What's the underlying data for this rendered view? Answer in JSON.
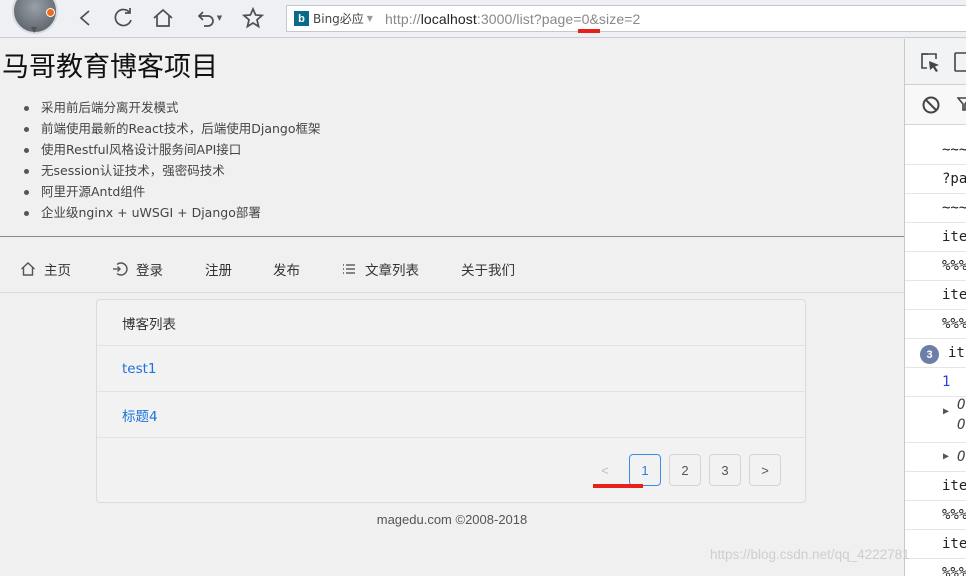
{
  "browser": {
    "search_engine": "Bing必应",
    "url_prefix": "http://",
    "url_host": "localhost",
    "url_rest": ":3000/list?page=0&size=2",
    "accent_mark_color": "#e8201a"
  },
  "site": {
    "title": "马哥教育博客项目",
    "features": [
      "采用前后端分离开发模式",
      "前端使用最新的React技术，后端使用Django框架",
      "使用Restful风格设计服务间API接口",
      "无session认证技术，强密码技术",
      "阿里开源Antd组件",
      "企业级nginx + uWSGI + Django部署"
    ],
    "menu": {
      "home": "主页",
      "login": "登录",
      "register": "注册",
      "publish": "发布",
      "articles": "文章列表",
      "about": "关于我们"
    },
    "list": {
      "header": "博客列表",
      "items": [
        "test1",
        "标题4"
      ]
    },
    "pagination": {
      "prev": "<",
      "pages": [
        "1",
        "2",
        "3"
      ],
      "next": ">",
      "current": "1"
    },
    "footer": "magedu.com ©2008-2018"
  },
  "devtools": {
    "lines": [
      "~~~",
      "?pa",
      "~~~",
      "ite",
      "%%%",
      "ite",
      "%%%",
      "it",
      "1",
      "O",
      "O",
      "O",
      "ite",
      "%%%",
      "ite",
      "%%%"
    ],
    "badge_count": "3"
  },
  "watermark": "https://blog.csdn.net/qq_4222781"
}
